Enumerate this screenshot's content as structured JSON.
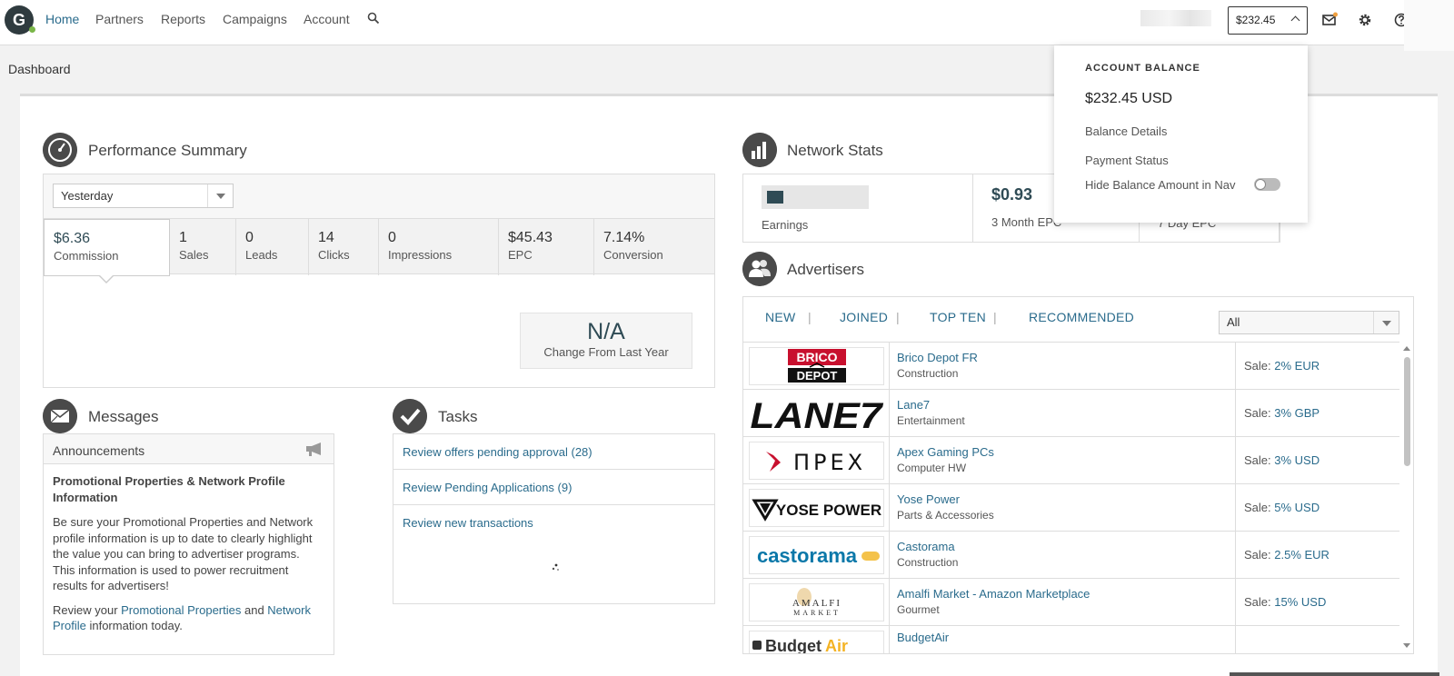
{
  "nav": {
    "logo": "G",
    "links": [
      "Home",
      "Partners",
      "Reports",
      "Campaigns",
      "Account"
    ],
    "balance_button": "$232.45"
  },
  "page_title": "Dashboard",
  "performance": {
    "title": "Performance Summary",
    "period": "Yesterday",
    "metrics": [
      {
        "value": "$6.36",
        "label": "Commission"
      },
      {
        "value": "1",
        "label": "Sales"
      },
      {
        "value": "0",
        "label": "Leads"
      },
      {
        "value": "14",
        "label": "Clicks"
      },
      {
        "value": "0",
        "label": "Impressions"
      },
      {
        "value": "$45.43",
        "label": "EPC"
      },
      {
        "value": "7.14%",
        "label": "Conversion"
      }
    ],
    "change_value": "N/A",
    "change_label": "Change From Last Year"
  },
  "messages": {
    "title": "Messages",
    "header": "Announcements",
    "heading": "Promotional Properties & Network Profile Information",
    "paragraph": "Be sure your Promotional Properties and Network profile information is up to date to clearly highlight the value you can bring to advertiser programs. This information is used to power recruitment results for advertisers!",
    "review_prefix": "Review your ",
    "link1": "Promotional Properties",
    "and": " and ",
    "link2": "Network Profile",
    "review_suffix": " information today."
  },
  "tasks": {
    "title": "Tasks",
    "items": [
      "Review offers pending approval (28)",
      "Review Pending Applications (9)",
      "Review new transactions"
    ]
  },
  "network_stats": {
    "title": "Network Stats",
    "cells": [
      {
        "value": "",
        "label": "Earnings"
      },
      {
        "value": "$0.93",
        "label": "3 Month EPC"
      },
      {
        "value": "",
        "label": "7 Day EPC"
      }
    ]
  },
  "advertisers": {
    "title": "Advertisers",
    "tabs": [
      "NEW",
      "JOINED",
      "TOP TEN",
      "RECOMMENDED"
    ],
    "filter": "All",
    "sale_prefix": "Sale: ",
    "rows": [
      {
        "logo": "BRICO DEPOT",
        "name": "Brico Depot FR",
        "category": "Construction",
        "rate": "2% EUR"
      },
      {
        "logo": "LANE7",
        "name": "Lane7",
        "category": "Entertainment",
        "rate": "3% GBP"
      },
      {
        "logo": "APEX",
        "name": "Apex Gaming PCs",
        "category": "Computer HW",
        "rate": "3% USD"
      },
      {
        "logo": "YOSE POWER",
        "name": "Yose Power",
        "category": "Parts & Accessories",
        "rate": "5% USD"
      },
      {
        "logo": "castorama",
        "name": "Castorama",
        "category": "Construction",
        "rate": "2.5% EUR"
      },
      {
        "logo": "AMALFI MARKET",
        "name": "Amalfi Market - Amazon Marketplace",
        "category": "Gourmet",
        "rate": "15% USD"
      },
      {
        "logo": "BudgetAir",
        "name": "BudgetAir",
        "category": "",
        "rate": ""
      }
    ]
  },
  "balance_dropdown": {
    "heading": "ACCOUNT BALANCE",
    "amount": "$232.45 USD",
    "links": [
      "Balance Details",
      "Payment Status"
    ],
    "toggle_label": "Hide Balance Amount in Nav"
  },
  "colors": {
    "accent": "#2a6b8c",
    "dark_value": "#2f4b55",
    "icon_bg": "#4a4a4a"
  }
}
